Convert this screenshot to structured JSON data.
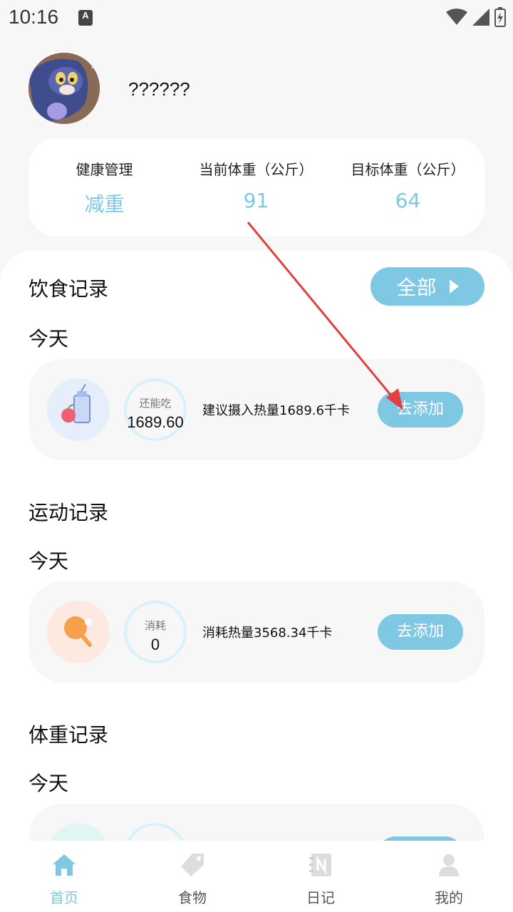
{
  "status_bar": {
    "time": "10:16",
    "notification": "A"
  },
  "profile": {
    "username": "??????"
  },
  "stats": [
    {
      "label": "健康管理",
      "value": "减重"
    },
    {
      "label": "当前体重（公斤）",
      "value": "91"
    },
    {
      "label": "目标体重（公斤）",
      "value": "64"
    }
  ],
  "diet": {
    "title": "饮食记录",
    "all_button": "全部",
    "today": "今天",
    "ring_label": "还能吃",
    "ring_value": "1689.60",
    "text": "建议摄入热量1689.6千卡",
    "add_button": "去添加"
  },
  "exercise": {
    "title": "运动记录",
    "today": "今天",
    "ring_label": "消耗",
    "ring_value": "0",
    "text": "消耗热量3568.34千卡",
    "add_button": "去添加"
  },
  "weight": {
    "title": "体重记录",
    "today": "今天"
  },
  "tabs": [
    {
      "label": "首页",
      "icon": "home-icon",
      "active": true
    },
    {
      "label": "食物",
      "icon": "tag-icon",
      "active": false
    },
    {
      "label": "日记",
      "icon": "diary-icon",
      "active": false
    },
    {
      "label": "我的",
      "icon": "person-icon",
      "active": false
    }
  ],
  "colors": {
    "accent": "#7ec8e3",
    "annotation_arrow": "#e04040"
  }
}
